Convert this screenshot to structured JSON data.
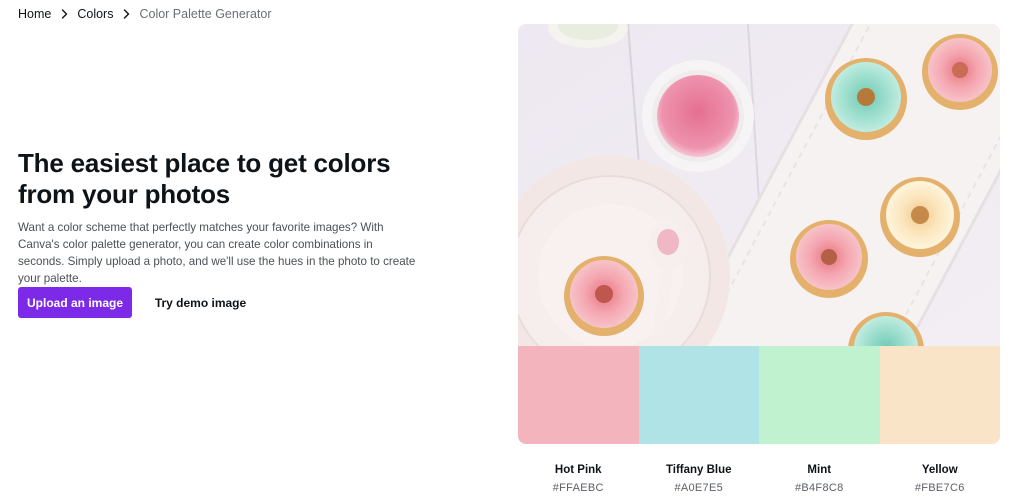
{
  "breadcrumb": {
    "items": [
      "Home",
      "Colors"
    ],
    "current": "Color Palette Generator"
  },
  "hero": {
    "title": "The easiest place to get colors from your photos",
    "description": "Want a color scheme that perfectly matches your favorite images? With Canva's color palette generator, you can create color combinations in seconds. Simply upload a photo, and we'll use the hues in the photo to create your palette.",
    "upload_button": "Upload an image",
    "demo_button": "Try demo image"
  },
  "palette": [
    {
      "name": "Hot Pink",
      "hex": "#FFAEBC"
    },
    {
      "name": "Tiffany Blue",
      "hex": "#A0E7E5"
    },
    {
      "name": "Mint",
      "hex": "#B4F8C8"
    },
    {
      "name": "Yellow",
      "hex": "#FBE7C6"
    }
  ],
  "colors": {
    "accent": "#7d2ae8",
    "swatch_hot_pink": "#F4B4BE",
    "swatch_tiffany_blue": "#B0E3E6",
    "swatch_mint": "#C0F2CF",
    "swatch_yellow": "#F9E4C7"
  }
}
